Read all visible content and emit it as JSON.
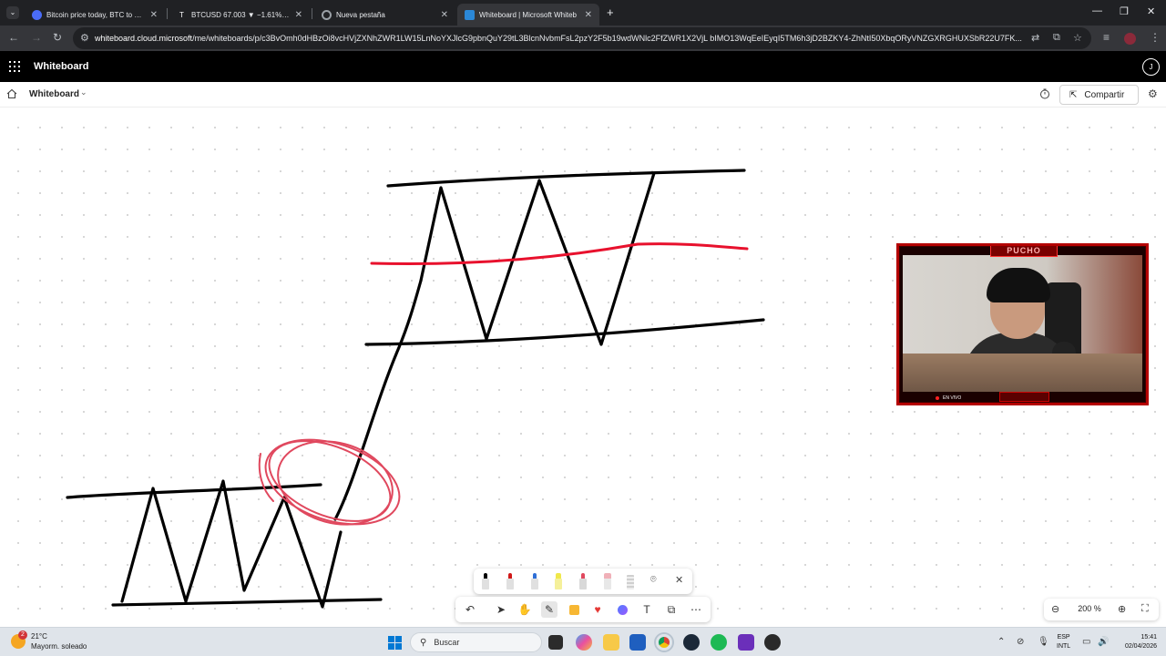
{
  "browser": {
    "tabs": [
      {
        "title": "Bitcoin price today, BTC to USD",
        "favicon_color": "#4a6cf7",
        "active": false
      },
      {
        "title": "BTCUSD 67.003 ▼ −1.61% Sin n",
        "favicon_color": "#ffffff",
        "active": false
      },
      {
        "title": "Nueva pestaña",
        "favicon_color": "#9aa0a6",
        "active": false
      },
      {
        "title": "Whiteboard | Microsoft Whiteb",
        "favicon_color": "#2b88d8",
        "active": true
      }
    ],
    "new_tab": "+",
    "url_host": "whiteboard.cloud.microsoft",
    "url_path": "/me/whiteboards/p/c3BvOmh0dHBzOi8vcHVjZXNhZWR1LW15LnNoYXJlcG9pbnQuY29tL3BlcnNvbmFsL2pzY2F5b19wdWNlc2FfZWR1X2VjL bIMO13WqEeIEyqI5TM6h3jD2BZKY4-ZhNtI50XbqORyVNZGXRGHUXSbR22U7FK..."
  },
  "app": {
    "title": "Whiteboard",
    "avatar_initial": "J"
  },
  "board": {
    "name": "Whiteboard",
    "share_label": "Compartir"
  },
  "webcam": {
    "brand": "PUCHO",
    "live_label": "EN VIVO"
  },
  "zoom": {
    "value": "200 %"
  },
  "colors": {
    "ink_black": "#000000",
    "ink_red": "#e8112d",
    "ink_pink": "#e0485e",
    "accent": "#b40000"
  },
  "taskbar": {
    "weather_temp": "21°C",
    "weather_desc": "Mayorm. soleado",
    "weather_badge": "2",
    "search_placeholder": "Buscar",
    "lang_top": "ESP",
    "lang_bottom": "INTL",
    "time": "15:41",
    "date": "02/04/2026"
  }
}
